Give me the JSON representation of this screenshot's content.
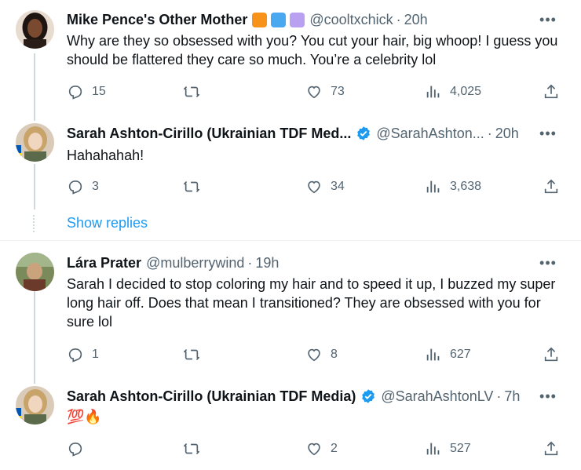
{
  "tweets": [
    {
      "name": "Mike Pence's Other Mother",
      "handle": "@cooltxchick",
      "time": "20h",
      "text": "Why are they so obsessed with you? You cut your hair, big whoop! I guess you should be flattered they care so much. You’re a celebrity lol",
      "badges": [
        "#f7931a",
        "#4aa8f0",
        "#b9a0f0"
      ],
      "replies": "15",
      "retweets": "",
      "likes": "73",
      "views": "4,025"
    },
    {
      "name": "Sarah Ashton-Cirillo (Ukrainian TDF Med...",
      "handle": "@SarahAshton...",
      "time": "20h",
      "text": "Hahahahah!",
      "replies": "3",
      "retweets": "",
      "likes": "34",
      "views": "3,638"
    },
    {
      "name": "Lára Prater",
      "handle": "@mulberrywind",
      "time": "19h",
      "text": "Sarah I decided to stop coloring my hair and to speed it up, I buzzed my super long hair off. Does that mean I transitioned? They are obsessed with you for sure lol",
      "replies": "1",
      "retweets": "",
      "likes": "8",
      "views": "627"
    },
    {
      "name": "Sarah Ashton-Cirillo (Ukrainian TDF Media)",
      "handle": "@SarahAshtonLV",
      "time": "7h",
      "text": "💯🔥",
      "replies": "",
      "retweets": "",
      "likes": "2",
      "views": "527"
    }
  ],
  "show_replies": "Show replies",
  "dot": "·",
  "more": "•••",
  "icons": {
    "reply": "reply-icon",
    "retweet": "retweet-icon",
    "like": "heart-icon",
    "views": "views-icon",
    "share": "share-icon",
    "verified": "verified-badge-icon"
  },
  "colors": {
    "accent": "#1d9bf0",
    "secondary_text": "#536471",
    "primary_text": "#0f1419"
  }
}
